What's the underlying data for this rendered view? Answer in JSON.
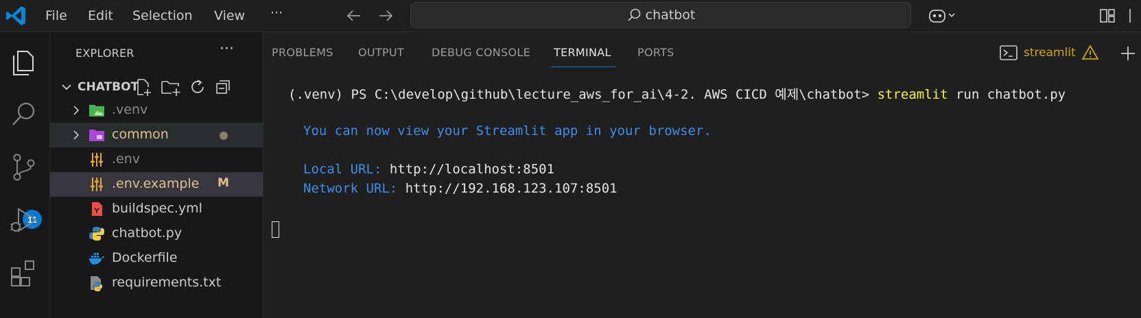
{
  "titlebar": {
    "menu": [
      "File",
      "Edit",
      "Selection",
      "View"
    ],
    "more_label": "···",
    "search_text": "chatbot"
  },
  "activitybar": {
    "items": [
      "explorer-icon",
      "search-icon",
      "source-control-icon",
      "run-debug-icon",
      "extensions-icon"
    ],
    "source_control_badge": "11"
  },
  "sidebar": {
    "title": "EXPLORER",
    "more_label": "···",
    "section": "CHATBOT",
    "tree": [
      {
        "label": ".venv",
        "color": "#8b8b8b",
        "icon": "folder-env-icon",
        "chevron": true
      },
      {
        "label": "common",
        "color": "#e2c08d",
        "icon": "folder-common-icon",
        "chevron": true,
        "dot": true
      },
      {
        "label": ".env",
        "color": "#8b8b8b",
        "icon": "env-settings-icon"
      },
      {
        "label": ".env.example",
        "color": "#e2c08d",
        "icon": "env-settings-icon",
        "modified": "M"
      },
      {
        "label": "buildspec.yml",
        "color": "#cccccc",
        "icon": "yaml-icon"
      },
      {
        "label": "chatbot.py",
        "color": "#cccccc",
        "icon": "python-icon"
      },
      {
        "label": "Dockerfile",
        "color": "#cccccc",
        "icon": "docker-icon"
      },
      {
        "label": "requirements.txt",
        "color": "#cccccc",
        "icon": "requirements-icon"
      }
    ]
  },
  "panel": {
    "tabs": [
      "PROBLEMS",
      "OUTPUT",
      "DEBUG CONSOLE",
      "TERMINAL",
      "PORTS"
    ],
    "active_tab": "TERMINAL",
    "terminal_name": "streamlit",
    "terminal": {
      "prompt": "(.venv) PS C:\\develop\\github\\lecture_aws_for_ai\\4-2. AWS CICD 예제\\chatbot> ",
      "command": "streamlit",
      "command_args": " run chatbot.py",
      "info": "You can now view your Streamlit app in your browser.",
      "local_label": "Local URL: ",
      "local_url": "http://localhost:8501",
      "network_label": "Network URL: ",
      "network_url": "http://192.168.123.107:8501"
    }
  },
  "colors": {
    "accent": "#0078d4",
    "warning": "#cca700",
    "modified": "#e2c08d"
  }
}
